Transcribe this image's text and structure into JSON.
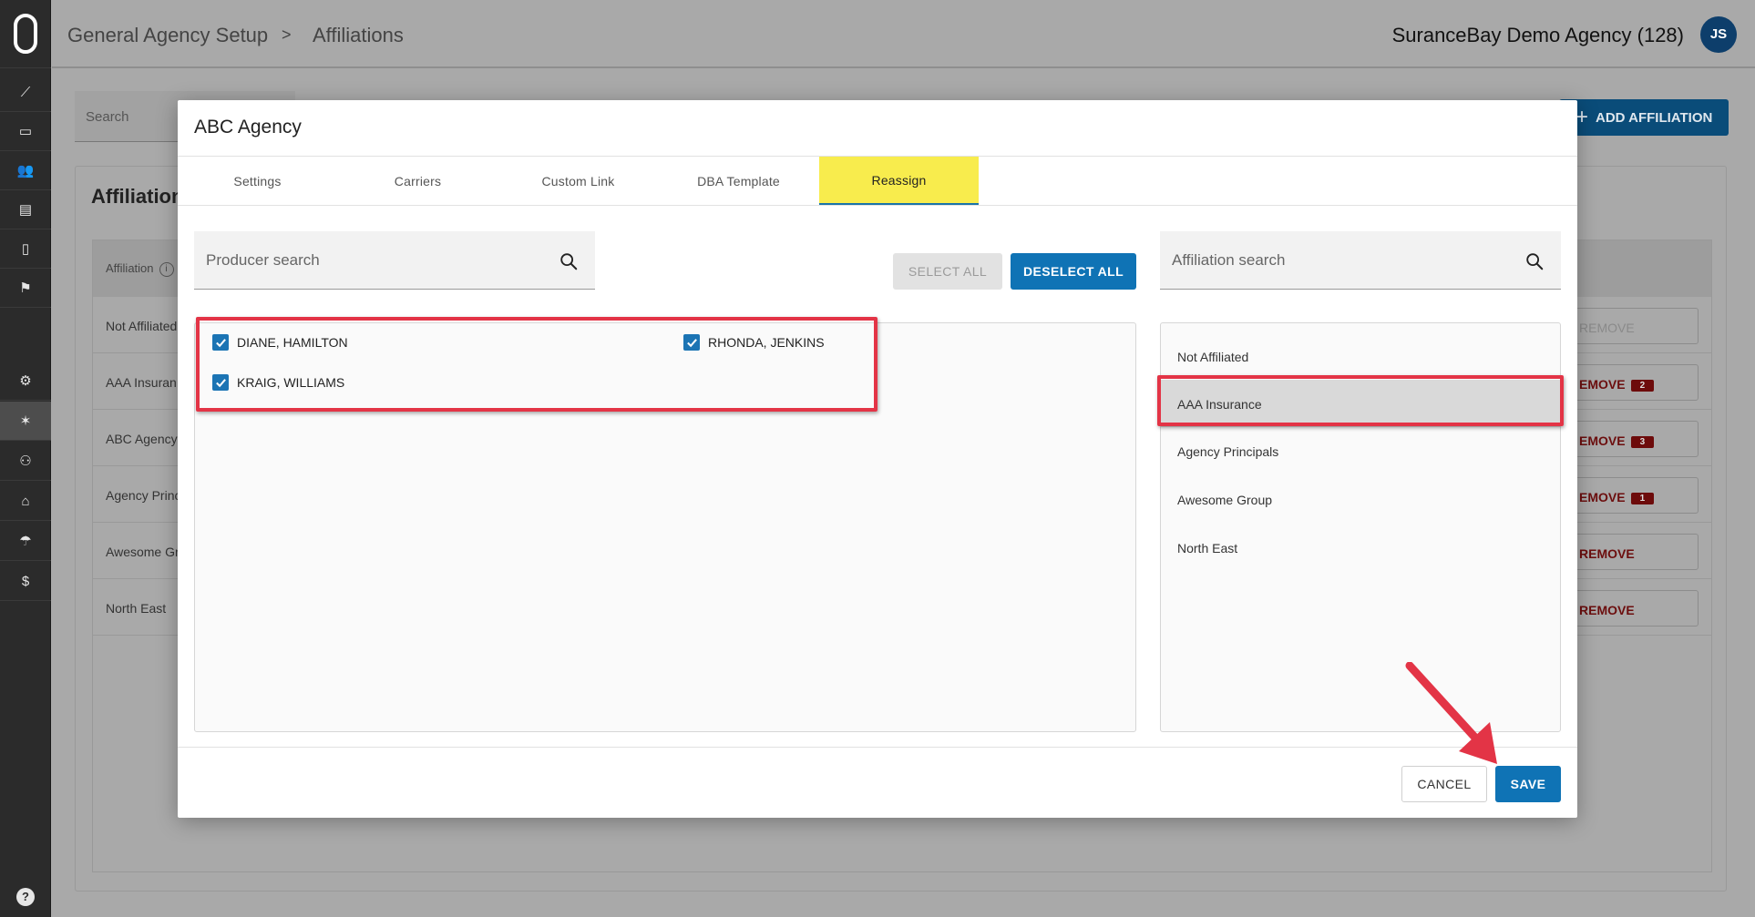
{
  "sidebar": {
    "logo": "surancebay-logo",
    "items": [
      {
        "icon": "analytics-icon",
        "glyph": "⟋"
      },
      {
        "icon": "monitor-icon",
        "glyph": "▭"
      },
      {
        "icon": "people-icon",
        "glyph": "👥"
      },
      {
        "icon": "store-icon",
        "glyph": "▤"
      },
      {
        "icon": "document-icon",
        "glyph": "▯"
      },
      {
        "icon": "flag-icon",
        "glyph": "⚑"
      },
      {
        "icon": "settings-icon",
        "glyph": "⚙"
      },
      {
        "icon": "affiliation-icon",
        "glyph": "✶"
      },
      {
        "icon": "user-settings-icon",
        "glyph": "⚇"
      },
      {
        "icon": "bank-icon",
        "glyph": "⌂"
      },
      {
        "icon": "umbrella-icon",
        "glyph": "☂"
      },
      {
        "icon": "dollar-icon",
        "glyph": "$"
      }
    ],
    "help_glyph": "?"
  },
  "header": {
    "breadcrumb": [
      "General Agency Setup",
      "Affiliations"
    ],
    "separator": ">",
    "agency_name": "SuranceBay Demo Agency (128)",
    "avatar_initials": "JS"
  },
  "background": {
    "search_placeholder": "Search",
    "add_button_label": "ADD AFFILIATION",
    "card_title": "Affiliation",
    "column_header": "Affiliation",
    "info_glyph": "i",
    "rows": [
      {
        "name": "Not Affiliated",
        "remove_label": "REMOVE",
        "disabled": true,
        "count": ""
      },
      {
        "name": "AAA Insuran",
        "remove_label": "EMOVE",
        "disabled": false,
        "count": "2"
      },
      {
        "name": "ABC Agency",
        "remove_label": "EMOVE",
        "disabled": false,
        "count": "3"
      },
      {
        "name": "Agency Princ",
        "remove_label": "EMOVE",
        "disabled": false,
        "count": "1"
      },
      {
        "name": "Awesome Gr",
        "remove_label": "REMOVE",
        "disabled": false,
        "count": ""
      },
      {
        "name": "North East",
        "remove_label": "REMOVE",
        "disabled": false,
        "count": ""
      }
    ]
  },
  "modal": {
    "title": "ABC Agency",
    "tabs": [
      {
        "label": "Settings",
        "active": false
      },
      {
        "label": "Carriers",
        "active": false
      },
      {
        "label": "Custom Link",
        "active": false
      },
      {
        "label": "DBA Template",
        "active": false
      },
      {
        "label": "Reassign",
        "active": true
      }
    ],
    "producer_search": {
      "placeholder": "Producer search",
      "value": ""
    },
    "select_all_label": "SELECT ALL",
    "deselect_all_label": "DESELECT ALL",
    "producers": [
      {
        "name": "DIANE, HAMILTON",
        "checked": true
      },
      {
        "name": "RHONDA, JENKINS",
        "checked": true
      },
      {
        "name": "KRAIG, WILLIAMS",
        "checked": true
      }
    ],
    "affiliation_search": {
      "placeholder": "Affiliation search",
      "value": ""
    },
    "affiliations": [
      {
        "name": "Not Affiliated",
        "selected": false
      },
      {
        "name": "AAA Insurance",
        "selected": true
      },
      {
        "name": "Agency Principals",
        "selected": false
      },
      {
        "name": "Awesome Group",
        "selected": false
      },
      {
        "name": "North East",
        "selected": false
      }
    ],
    "cancel_label": "CANCEL",
    "save_label": "SAVE"
  },
  "colors": {
    "primary": "#0f73b5",
    "active_tab_highlight": "#f8ec4d",
    "annotation_red": "#e33446",
    "sidebar": "#2b2b2b",
    "overlay_gray": "#a9a9a9"
  }
}
